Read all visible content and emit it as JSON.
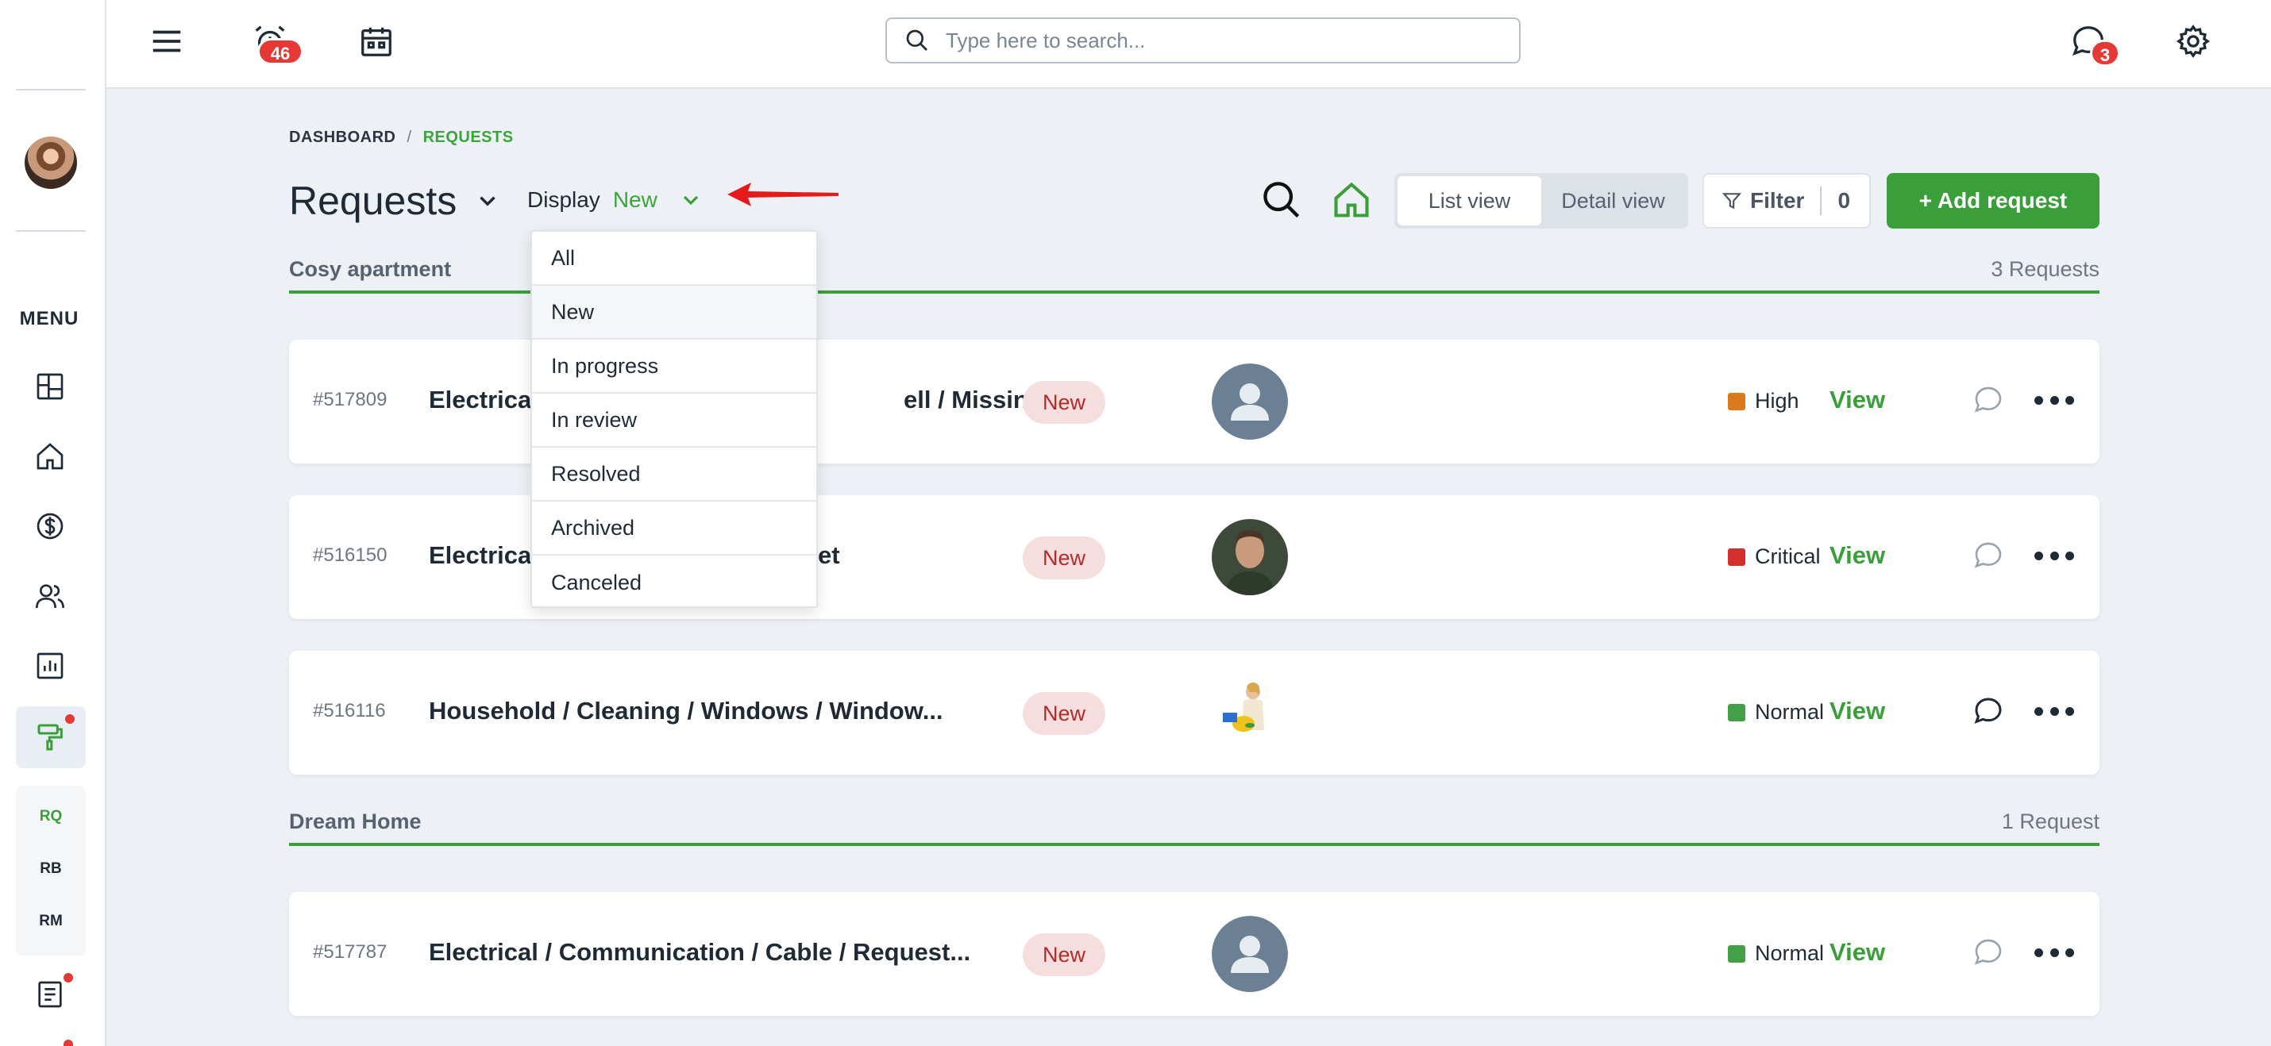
{
  "sidebar": {
    "menu_label": "MENU",
    "sub_items": [
      "RQ",
      "RB",
      "RM"
    ],
    "icons": [
      "dashboard-icon",
      "home-icon",
      "dollar-icon",
      "users-icon",
      "report-icon",
      "paint-roller-icon",
      "document-icon"
    ]
  },
  "topbar": {
    "alarm_badge": "46",
    "chat_badge": "3",
    "search_placeholder": "Type here to search..."
  },
  "breadcrumb": {
    "root": "DASHBOARD",
    "separator": "/",
    "current": "REQUESTS"
  },
  "page": {
    "title": "Requests",
    "display_label": "Display",
    "display_value": "New"
  },
  "toolbar": {
    "list_view": "List view",
    "detail_view": "Detail view",
    "filter_label": "Filter",
    "filter_count": "0",
    "add_label": "+ Add request"
  },
  "dropdown": {
    "options": [
      "All",
      "New",
      "In progress",
      "In review",
      "Resolved",
      "Archived",
      "Canceled"
    ],
    "selected": "New"
  },
  "groups": [
    {
      "name": "Cosy apartment",
      "count": "3 Requests",
      "requests": [
        {
          "id": "#517809",
          "title_left": "Electrical",
          "title_right": "ell / Missing",
          "status": "New",
          "priority": "High",
          "priority_color": "#d97a1e",
          "view": "View"
        },
        {
          "id": "#516150",
          "title_left": "Electrical",
          "title_right": "et",
          "status": "New",
          "priority": "Critical",
          "priority_color": "#d32f2f",
          "view": "View"
        },
        {
          "id": "#516116",
          "title": "Household / Cleaning / Windows / Window...",
          "status": "New",
          "priority": "Normal",
          "priority_color": "#43a047",
          "view": "View"
        }
      ]
    },
    {
      "name": "Dream Home",
      "count": "1 Request",
      "requests": [
        {
          "id": "#517787",
          "title": "Electrical / Communication / Cable / Request...",
          "status": "New",
          "priority": "Normal",
          "priority_color": "#43a047",
          "view": "View"
        }
      ]
    }
  ],
  "colors": {
    "accent": "#3a9f3a",
    "badge": "#e53935",
    "status_bg": "#f6dede",
    "status_text": "#b12b2b"
  }
}
